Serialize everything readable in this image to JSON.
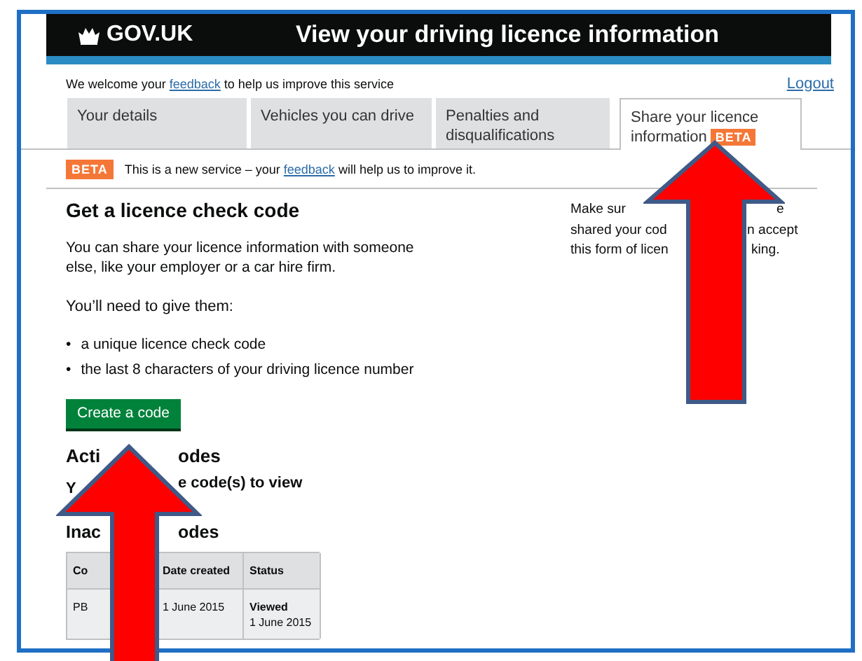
{
  "header": {
    "logo": "GOV.UK",
    "title": "View your driving licence information"
  },
  "feedback_bar": {
    "before": "We welcome your",
    "link": "feedback",
    "after": "to help us improve this service",
    "logout": "Logout"
  },
  "tabs": [
    {
      "label": "Your details",
      "selected": false
    },
    {
      "label": "Vehicles you can drive",
      "selected": false
    },
    {
      "label": "Penalties and disqualifications",
      "selected": false
    },
    {
      "label": "Share your licence information",
      "badge": "BETA",
      "selected": true
    }
  ],
  "beta_banner": {
    "tag": "BETA",
    "before": "This is a new service – your",
    "link": "feedback",
    "after": "will help us to improve it."
  },
  "main": {
    "heading": "Get a licence check code",
    "intro": "You can share your licence information with someone else, like your employer or a car hire firm.",
    "need": "You’ll need to give them:",
    "bullets": [
      {
        "marker": "•",
        "text": "a unique licence check code"
      },
      {
        "marker": "•",
        "text": "the last 8 characters of your driving licence number"
      }
    ],
    "button": "Create a code"
  },
  "active": {
    "heading": [
      "Acti",
      "odes"
    ],
    "message": [
      "Y",
      "e code(s) to view"
    ]
  },
  "inactive": {
    "heading": [
      "Inac",
      "odes"
    ],
    "columns": [
      "Co",
      "Date created",
      "Status"
    ],
    "rows": [
      {
        "code": "PB",
        "date": "1 June 2015",
        "status": "Viewed",
        "status_date": "1 June 2015"
      }
    ]
  },
  "side_note": [
    [
      "Make sur",
      "e"
    ],
    [
      "shared your cod",
      "n accept"
    ],
    [
      "this form of licen",
      "king."
    ]
  ]
}
